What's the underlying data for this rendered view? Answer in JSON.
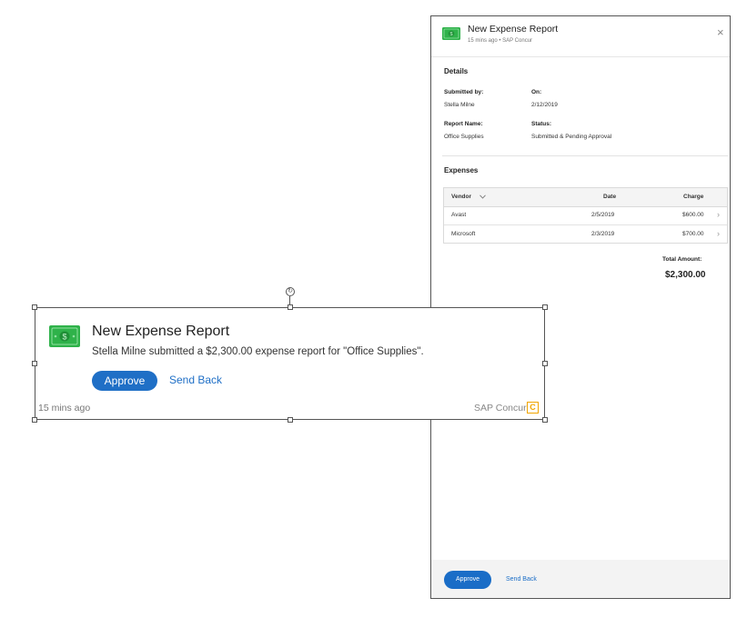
{
  "panel": {
    "title": "New Expense Report",
    "subtitle": "15 mins ago • SAP Concur",
    "close_glyph": "×",
    "details": {
      "heading": "Details",
      "submitted_by_label": "Submitted by:",
      "submitted_by_value": "Stella Milne",
      "on_label": "On:",
      "on_value": "2/12/2019",
      "report_name_label": "Report Name:",
      "report_name_value": "Office Supplies",
      "status_label": "Status:",
      "status_value": "Submitted & Pending Approval"
    },
    "expenses": {
      "heading": "Expenses",
      "columns": [
        "Vendor",
        "Date",
        "Charge"
      ],
      "rows": [
        {
          "vendor": "Avast",
          "date": "2/5/2019",
          "charge": "$600.00"
        },
        {
          "vendor": "Microsoft",
          "date": "2/3/2019",
          "charge": "$700.00"
        }
      ]
    },
    "total_label": "Total Amount:",
    "total_value": "$2,300.00",
    "approve_label": "Approve",
    "send_back_label": "Send Back"
  },
  "toast": {
    "title": "New Expense Report",
    "message": "Stella Milne submitted a $2,300.00 expense report for \"Office Supplies\".",
    "approve_label": "Approve",
    "send_back_label": "Send Back",
    "time": "15 mins ago",
    "source": "SAP Concur",
    "logo_letter": "C"
  },
  "colors": {
    "accent": "#1f6fc6",
    "money_green": "#2fb24a",
    "concur_orange": "#f0a500"
  },
  "icons": [
    "money-icon",
    "close-icon",
    "chevron-down-icon",
    "chevron-right-icon",
    "rotate-icon",
    "sap-concur-logo"
  ]
}
